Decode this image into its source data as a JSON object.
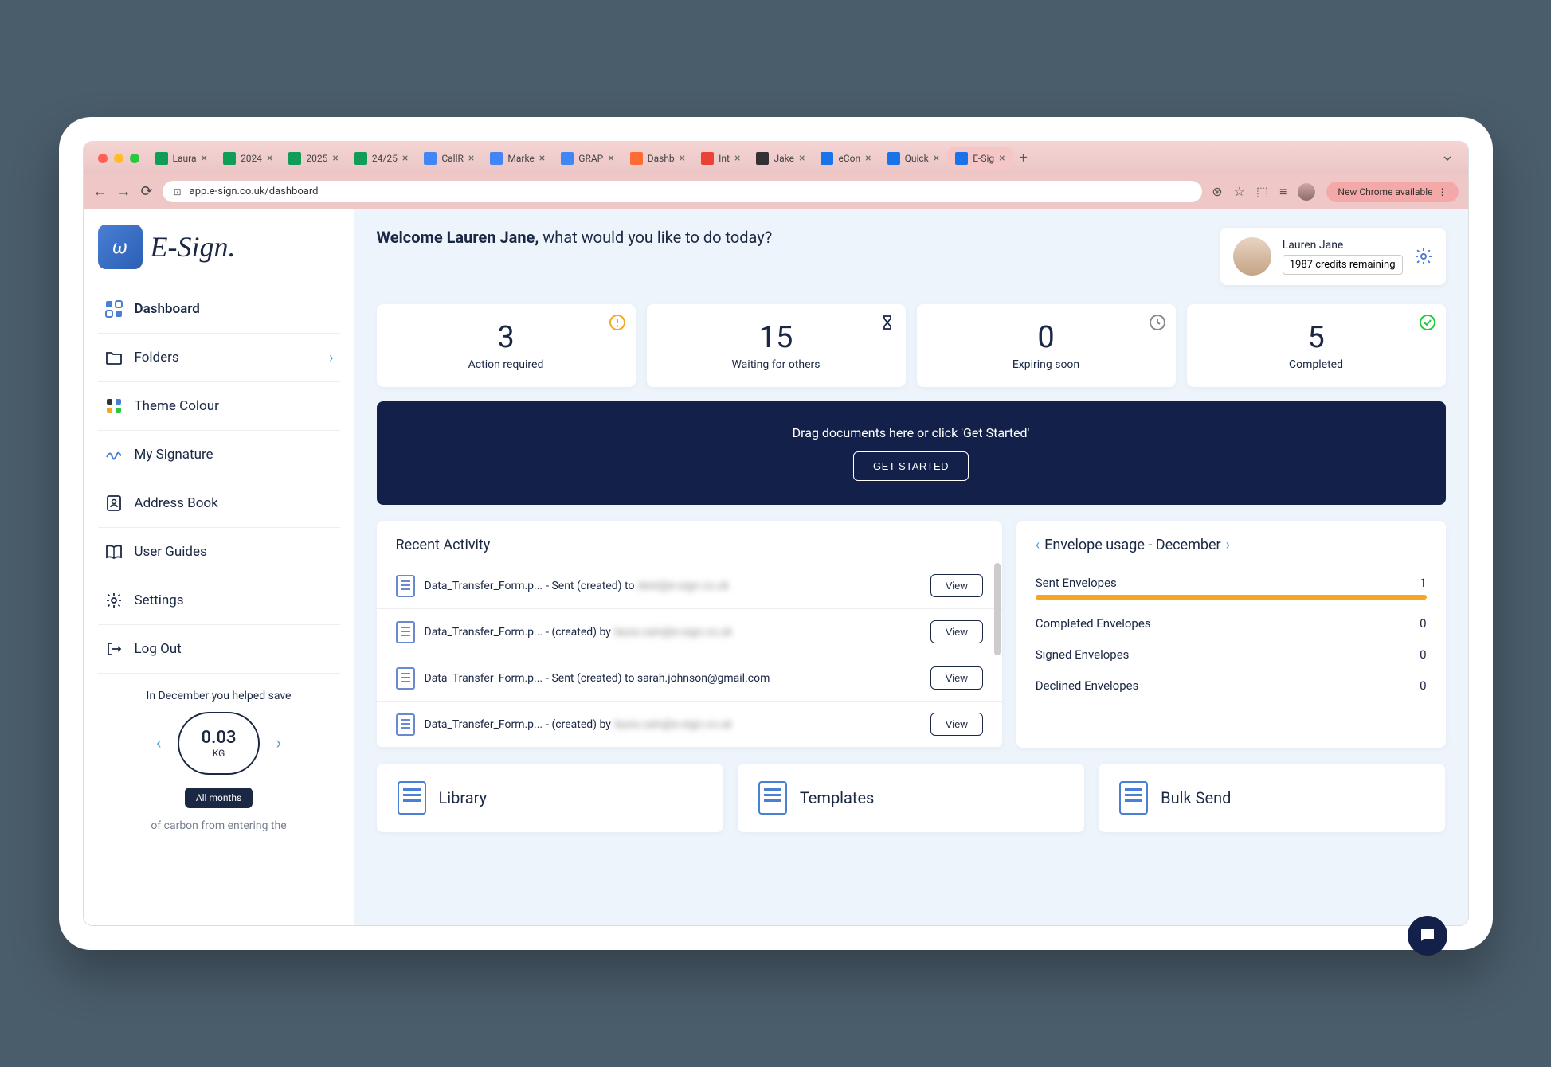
{
  "browser": {
    "tabs": [
      {
        "icon": "sheets",
        "label": "Laura"
      },
      {
        "icon": "sheets",
        "label": "2024"
      },
      {
        "icon": "sheets",
        "label": "2025"
      },
      {
        "icon": "sheets",
        "label": "24/25"
      },
      {
        "icon": "callr",
        "label": "CallR"
      },
      {
        "icon": "marke",
        "label": "Marke"
      },
      {
        "icon": "grap",
        "label": "GRAP"
      },
      {
        "icon": "dashb",
        "label": "Dashb"
      },
      {
        "icon": "int",
        "label": "Int"
      },
      {
        "icon": "jake",
        "label": "Jake"
      },
      {
        "icon": "econ",
        "label": "eCon"
      },
      {
        "icon": "quick",
        "label": "Quick"
      },
      {
        "icon": "esign",
        "label": "E-Sig",
        "active": true
      }
    ],
    "url": "app.e-sign.co.uk/dashboard",
    "chrome_pill": "New Chrome available"
  },
  "logo_text": "E-Sign.",
  "sidebar": {
    "items": [
      {
        "label": "Dashboard",
        "icon": "dashboard",
        "active": true
      },
      {
        "label": "Folders",
        "icon": "folder",
        "chevron": true
      },
      {
        "label": "Theme Colour",
        "icon": "palette"
      },
      {
        "label": "My Signature",
        "icon": "signature"
      },
      {
        "label": "Address Book",
        "icon": "addressbook"
      },
      {
        "label": "User Guides",
        "icon": "book"
      },
      {
        "label": "Settings",
        "icon": "gear"
      },
      {
        "label": "Log Out",
        "icon": "logout"
      }
    ],
    "eco": {
      "intro": "In December you helped save",
      "value": "0.03",
      "unit": "KG",
      "all_months": "All months",
      "footer": "of carbon from entering the"
    }
  },
  "welcome": {
    "bold": "Welcome Lauren Jane,",
    "rest": " what would you like to do today?"
  },
  "user": {
    "name": "Lauren Jane",
    "credits": "1987 credits remaining"
  },
  "stats": [
    {
      "num": "3",
      "label": "Action required",
      "icon": "alert",
      "color": "#f5a623"
    },
    {
      "num": "15",
      "label": "Waiting for others",
      "icon": "hourglass",
      "color": "#1a2844"
    },
    {
      "num": "0",
      "label": "Expiring soon",
      "icon": "clock",
      "color": "#888"
    },
    {
      "num": "5",
      "label": "Completed",
      "icon": "check",
      "color": "#27c93f"
    }
  ],
  "dropzone": {
    "text": "Drag documents here or click 'Get Started'",
    "button": "GET STARTED"
  },
  "recent": {
    "title": "Recent Activity",
    "items": [
      {
        "file": "Data_Transfer_Form.p...",
        "status": " - Sent (created) to ",
        "blur": "dest@e-sign.co.uk",
        "button": "View"
      },
      {
        "file": "Data_Transfer_Form.p...",
        "status": " - (created) by ",
        "blur": "laura.cain@e-sign.co.uk",
        "button": "View"
      },
      {
        "file": "Data_Transfer_Form.p...",
        "status": " - Sent (created) to sarah.johnson@gmail.com",
        "blur": "",
        "button": "View"
      },
      {
        "file": "Data_Transfer_Form.p...",
        "status": " - (created) by ",
        "blur": "laura.cain@e-sign.co.uk",
        "button": "View"
      }
    ]
  },
  "usage": {
    "title": "Envelope usage - December",
    "rows": [
      {
        "label": "Sent Envelopes",
        "value": "1",
        "bar": true
      },
      {
        "label": "Completed Envelopes",
        "value": "0"
      },
      {
        "label": "Signed Envelopes",
        "value": "0"
      },
      {
        "label": "Declined Envelopes",
        "value": "0"
      }
    ]
  },
  "quick": [
    {
      "label": "Library"
    },
    {
      "label": "Templates"
    },
    {
      "label": "Bulk Send"
    }
  ]
}
